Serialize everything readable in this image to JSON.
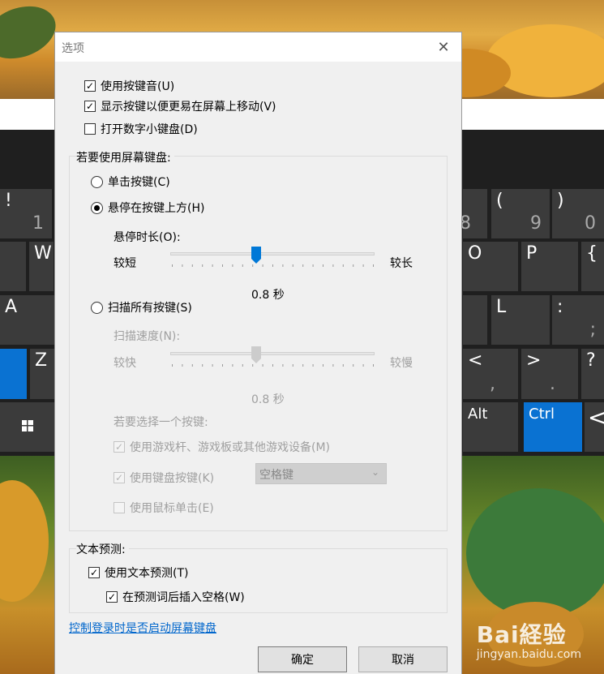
{
  "dialog": {
    "title": "选项",
    "close_glyph": "✕",
    "checkmark": "✓",
    "options": {
      "use_click_sound": "使用按键音(U)",
      "show_keys_easier": "显示按键以便更易在屏幕上移动(V)",
      "turn_on_numpad": "打开数字小键盘(D)"
    },
    "use_osk": {
      "label": "若要使用屏幕键盘:",
      "click_keys": "单击按键(C)",
      "hover_keys": "悬停在按键上方(H)",
      "hover_duration": {
        "label": "悬停时长(O):",
        "min": "较短",
        "max": "较长",
        "value": "0.8 秒",
        "level": 0.42
      },
      "scan_keys": "扫描所有按键(S)",
      "scan_speed": {
        "label": "扫描速度(N):",
        "min": "较快",
        "max": "较慢",
        "value": "0.8 秒",
        "level": 0.42
      },
      "select_key_label": "若要选择一个按键:",
      "use_joystick": "使用游戏杆、游戏板或其他游戏设备(M)",
      "use_keyboard_key": "使用键盘按键(K)",
      "keyboard_key_value": "空格键",
      "use_mouse_click": "使用鼠标单击(E)"
    },
    "text_prediction": {
      "label": "文本预测:",
      "use_prediction": "使用文本预测(T)",
      "insert_space": "在预测词后插入空格(W)"
    },
    "control_login_link": "控制登录时是否启动屏幕键盘",
    "ok_button": "确定",
    "cancel_button": "取消"
  },
  "keyboard": {
    "row1": [
      {
        "top": "!",
        "bottom": "1"
      },
      {
        "top": "",
        "bottom": "8"
      },
      {
        "top": "(",
        "bottom": "9"
      },
      {
        "top": ")",
        "bottom": "0"
      }
    ],
    "row2": [
      "W",
      "O",
      "P",
      "{"
    ],
    "row3": [
      "A",
      "L",
      ":",
      ";"
    ],
    "row4": [
      "Z",
      "<",
      ",",
      ">",
      ".",
      "?"
    ],
    "row5": [
      "Alt",
      "Ctrl",
      "<"
    ]
  },
  "watermark": {
    "line1": "Bai経验",
    "line2": "jingyan.baidu.com"
  },
  "colors": {
    "accent": "#0a72d2",
    "slider_thumb": "#0078d7",
    "link": "#0066cc"
  }
}
